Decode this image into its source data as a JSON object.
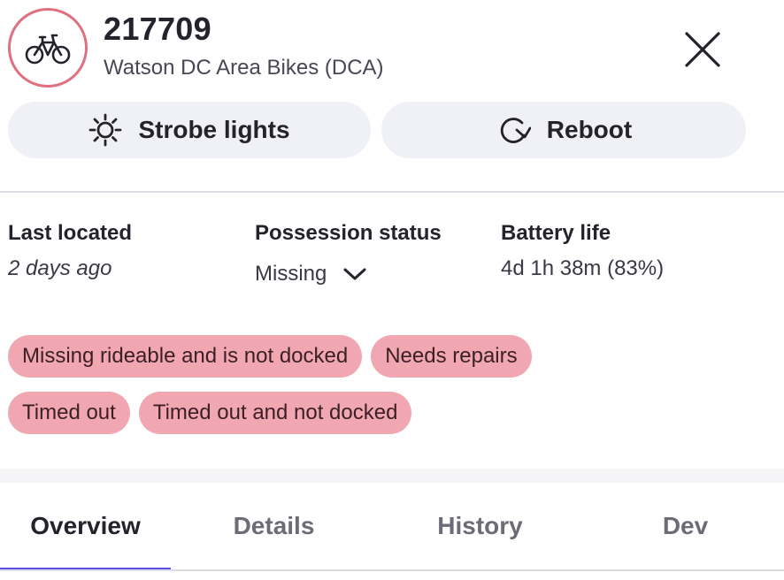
{
  "vehicle": {
    "id": "217709",
    "fleet": "Watson DC Area Bikes (DCA)",
    "icon": "bicycle-icon",
    "accent_color": "#e0707f"
  },
  "actions": {
    "strobe_label": "Strobe lights",
    "reboot_label": "Reboot"
  },
  "stats": {
    "last_located_label": "Last located",
    "last_located_value": "2 days ago",
    "possession_label": "Possession status",
    "possession_value": "Missing",
    "battery_label": "Battery life",
    "battery_value": "4d 1h 38m (83%)"
  },
  "tags": {
    "color": "#f1a7b1",
    "items": [
      "Missing rideable and is not docked",
      "Needs repairs",
      "Timed out",
      "Timed out and not docked"
    ]
  },
  "tabs": {
    "active_color": "#5b4ee6",
    "items": [
      {
        "label": "Overview",
        "active": true
      },
      {
        "label": "Details",
        "active": false
      },
      {
        "label": "History",
        "active": false
      },
      {
        "label": "Dev",
        "active": false
      }
    ]
  }
}
